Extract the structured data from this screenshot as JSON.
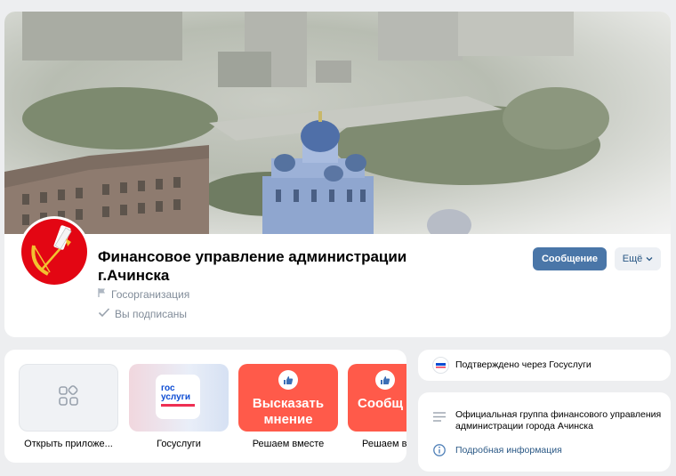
{
  "group": {
    "name": "Финансовое управление администрации г.Ачинска",
    "category": "Госорганизация",
    "subscribed_label": "Вы подписаны",
    "message_button": "Сообщение",
    "more_button": "Ещё"
  },
  "apps": [
    {
      "label": "Открыть приложе...",
      "icon": "apps-grid-icon"
    },
    {
      "label": "Госуслуги",
      "icon": "gosuslugi-logo",
      "logo_line1": "гос",
      "logo_line2": "услуги"
    },
    {
      "label": "Решаем вместе",
      "icon": "thumbs-up-shield-icon",
      "tile_text": "Высказать мнение"
    },
    {
      "label": "Решаем в",
      "icon": "thumbs-up-shield-icon",
      "tile_text": "Сообщ о пробл"
    }
  ],
  "sidebar": {
    "verified_text": "Подтверждено через Госуслуги",
    "description": "Официальная группа финансового управления администрации города Ачинска",
    "more_info": "Подробная информация"
  },
  "colors": {
    "accent": "#4a76a8",
    "link": "#2a5885",
    "tile_red": "#ff5a4a",
    "avatar_red": "#e30613"
  }
}
